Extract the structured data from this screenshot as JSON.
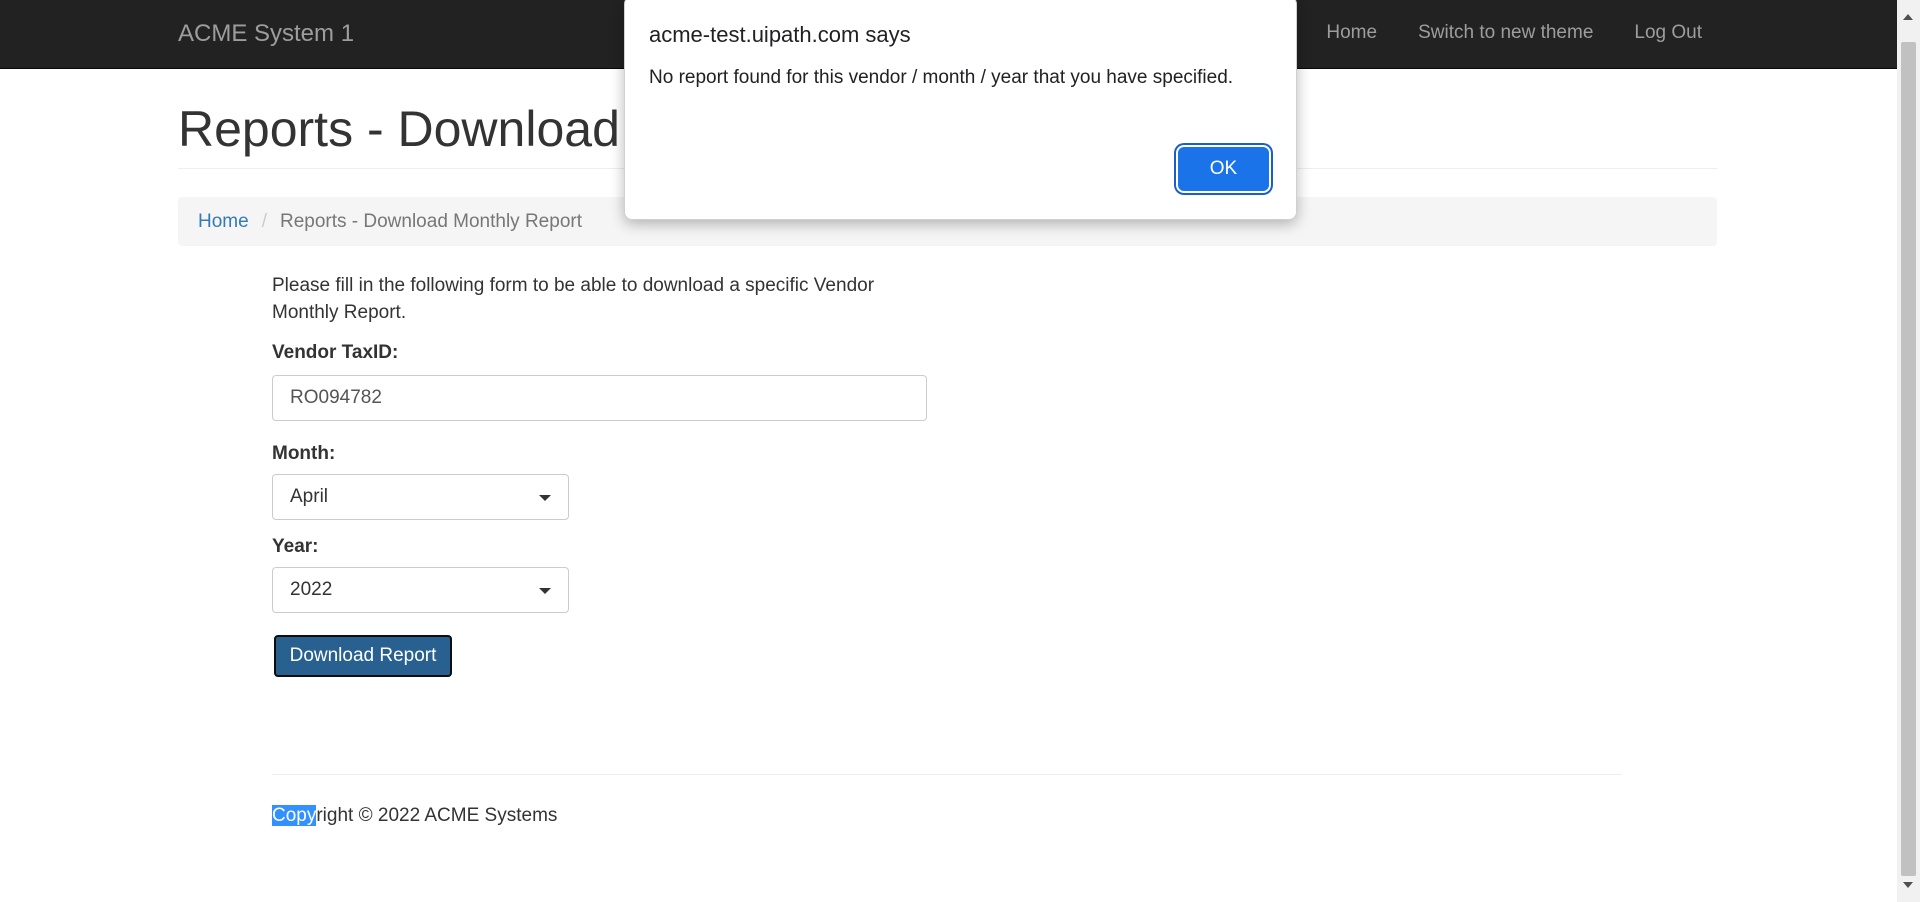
{
  "navbar": {
    "brand": "ACME System 1",
    "links": [
      "Home",
      "Switch to new theme",
      "Log Out"
    ]
  },
  "page": {
    "title": "Reports - Download Monthly Report"
  },
  "breadcrumb": {
    "home": "Home",
    "separator": "/",
    "current": "Reports - Download Monthly Report"
  },
  "form": {
    "intro": "Please fill in the following form to be able to download a specific Vendor Monthly Report.",
    "vendor_label": "Vendor TaxID:",
    "vendor_value": "RO094782",
    "month_label": "Month:",
    "month_value": "April",
    "year_label": "Year:",
    "year_value": "2022",
    "submit_label": "Download Report"
  },
  "footer": {
    "selected": "Copy",
    "rest": "right © 2022 ACME Systems"
  },
  "dialog": {
    "title": "acme-test.uipath.com says",
    "message": "No report found for this vendor / month / year that you have specified.",
    "ok_label": "OK"
  },
  "colors": {
    "navbar_bg": "#222222",
    "primary_button": "#286090",
    "dialog_button": "#1a73e8",
    "link": "#337ab7"
  }
}
